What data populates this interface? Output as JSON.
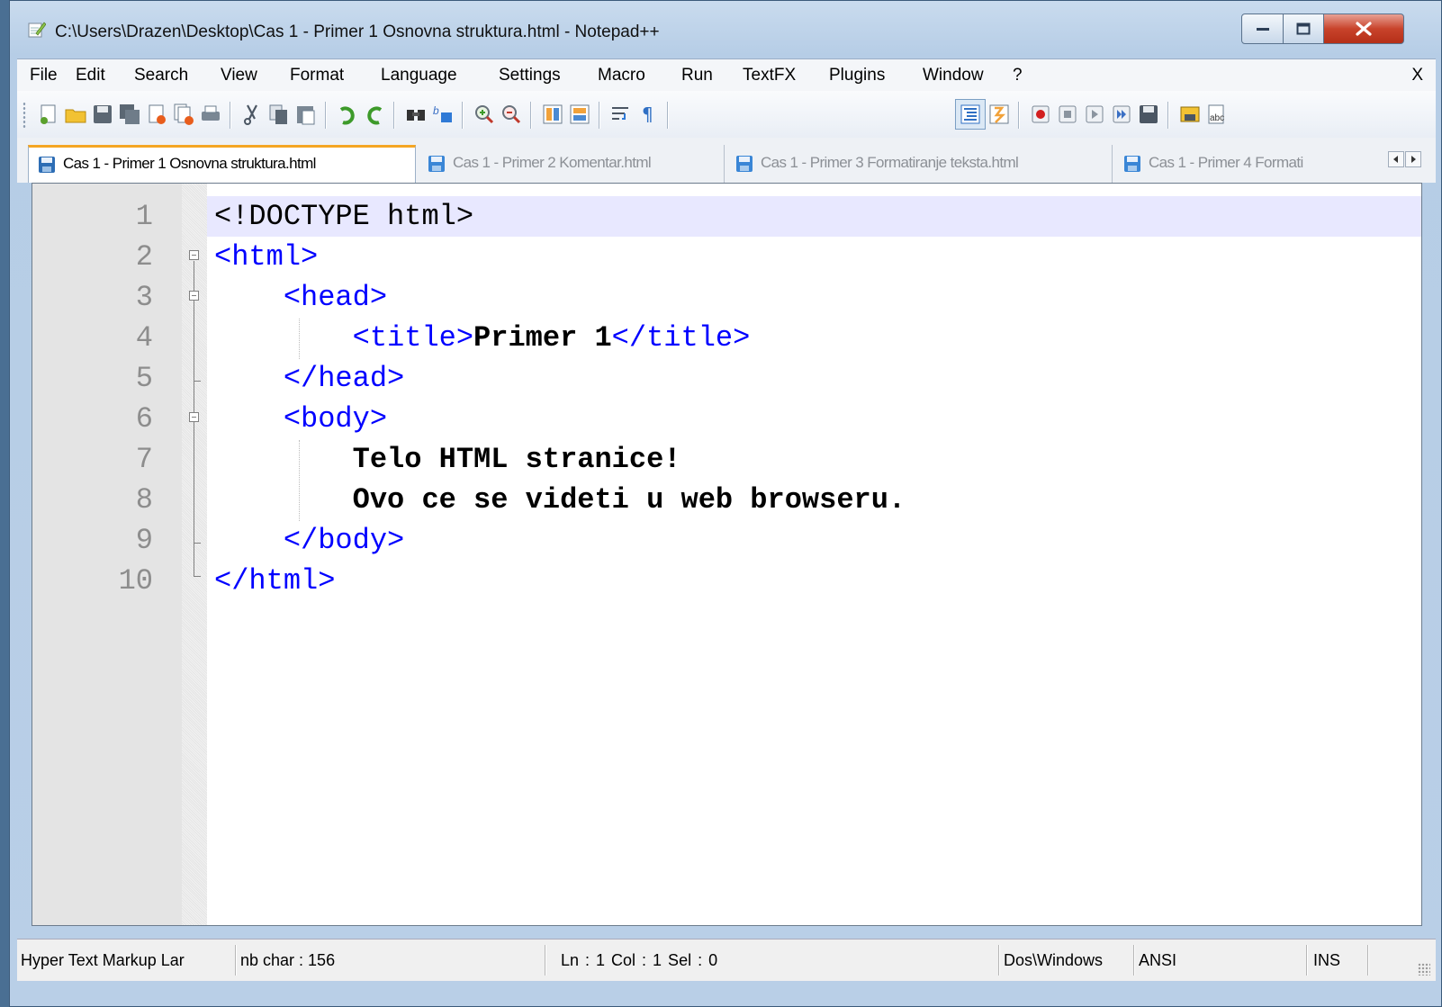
{
  "window": {
    "title": "C:\\Users\\Drazen\\Desktop\\Cas 1 - Primer 1 Osnovna struktura.html - Notepad++"
  },
  "menu": {
    "items": [
      "File",
      "Edit",
      "Search",
      "View",
      "Format",
      "Language",
      "Settings",
      "Macro",
      "Run",
      "TextFX",
      "Plugins",
      "Window",
      "?"
    ],
    "close_label": "X"
  },
  "toolbar": {
    "buttons": [
      "new-file-icon",
      "open-file-icon",
      "save-icon",
      "save-all-icon",
      "close-icon",
      "close-all-icon",
      "print-icon",
      "cut-icon",
      "copy-icon",
      "paste-icon",
      "undo-icon",
      "redo-icon",
      "find-icon",
      "replace-icon",
      "zoom-in-icon",
      "zoom-out-icon",
      "sync-vertical-icon",
      "sync-horizontal-icon",
      "word-wrap-icon",
      "show-all-chars-icon",
      "indent-guide-icon",
      "user-lang-icon",
      "record-macro-icon",
      "stop-record-icon",
      "play-macro-icon",
      "run-macro-multiple-icon",
      "save-macro-icon",
      "trim-icon",
      "spell-check-icon"
    ]
  },
  "tabs": [
    {
      "label": "Cas 1 - Primer 1 Osnovna struktura.html",
      "active": true
    },
    {
      "label": "Cas 1 - Primer 2 Komentar.html",
      "active": false
    },
    {
      "label": "Cas 1 - Primer 3 Formatiranje teksta.html",
      "active": false
    },
    {
      "label": "Cas 1 - Primer 4 Formati",
      "active": false
    }
  ],
  "editor": {
    "line_numbers": [
      "1",
      "2",
      "3",
      "4",
      "5",
      "6",
      "7",
      "8",
      "9",
      "10"
    ],
    "lines": [
      {
        "indent": "",
        "parts": [
          {
            "t": "plain",
            "v": "<!DOCTYPE html>"
          }
        ]
      },
      {
        "indent": "",
        "parts": [
          {
            "t": "tag",
            "v": "<html>"
          }
        ]
      },
      {
        "indent": "    ",
        "parts": [
          {
            "t": "tag",
            "v": "<head>"
          }
        ]
      },
      {
        "indent": "        ",
        "parts": [
          {
            "t": "tag",
            "v": "<title>"
          },
          {
            "t": "txt",
            "v": "Primer 1"
          },
          {
            "t": "tag",
            "v": "</title>"
          }
        ]
      },
      {
        "indent": "    ",
        "parts": [
          {
            "t": "tag",
            "v": "</head>"
          }
        ]
      },
      {
        "indent": "    ",
        "parts": [
          {
            "t": "tag",
            "v": "<body>"
          }
        ]
      },
      {
        "indent": "        ",
        "parts": [
          {
            "t": "txt",
            "v": "Telo HTML stranice!"
          }
        ]
      },
      {
        "indent": "        ",
        "parts": [
          {
            "t": "txt",
            "v": "Ovo ce se videti u web browseru."
          }
        ]
      },
      {
        "indent": "    ",
        "parts": [
          {
            "t": "tag",
            "v": "</body>"
          }
        ]
      },
      {
        "indent": "",
        "parts": [
          {
            "t": "tag",
            "v": "</html>"
          }
        ]
      }
    ]
  },
  "status": {
    "language": "Hyper Text Markup Lar",
    "length": "nb char : 156",
    "position": "Ln : 1    Col : 1    Sel : 0",
    "eol": "Dos\\Windows",
    "encoding": "ANSI",
    "mode": "INS"
  },
  "colors": {
    "tag": "#0000ff",
    "text": "#000000",
    "current_line": "#e8e8ff",
    "gutter": "#e4e4e4",
    "active_tab_accent": "#f5a623"
  }
}
